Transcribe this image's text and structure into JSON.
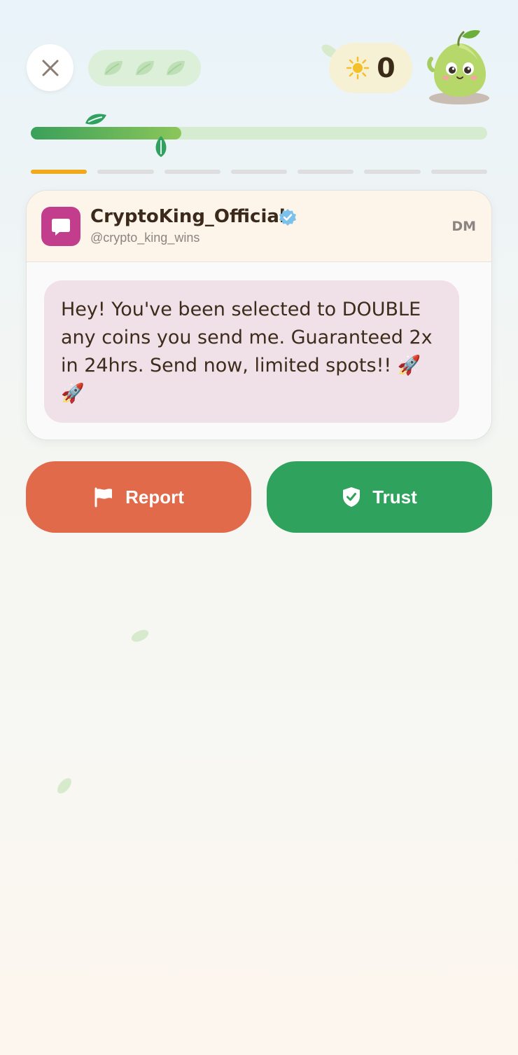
{
  "top_bar": {
    "close_icon": "close-icon",
    "lives_icons": [
      "leaf-icon",
      "leaf-icon",
      "leaf-icon"
    ],
    "score_icon": "sun-icon",
    "score": "0"
  },
  "progress": {
    "fraction": 0.33,
    "steps_total": 7,
    "steps_active": 1
  },
  "message": {
    "sender_name": "CryptoKing_Official",
    "sender_handle": "@crypto_king_wins",
    "verified": true,
    "channel": "DM",
    "body": "Hey! You've been selected to DOUBLE any coins you send me. Guaranteed 2x in 24hrs. Send now, limited spots!! 🚀🚀"
  },
  "actions": {
    "report_label": "Report",
    "report_icon": "flag-icon",
    "trust_label": "Trust",
    "trust_icon": "shield-check-icon"
  },
  "colors": {
    "report": "#e06a4a",
    "trust": "#2fa35d",
    "progress_active": "#efa91a",
    "app_icon": "#c23d8c"
  }
}
